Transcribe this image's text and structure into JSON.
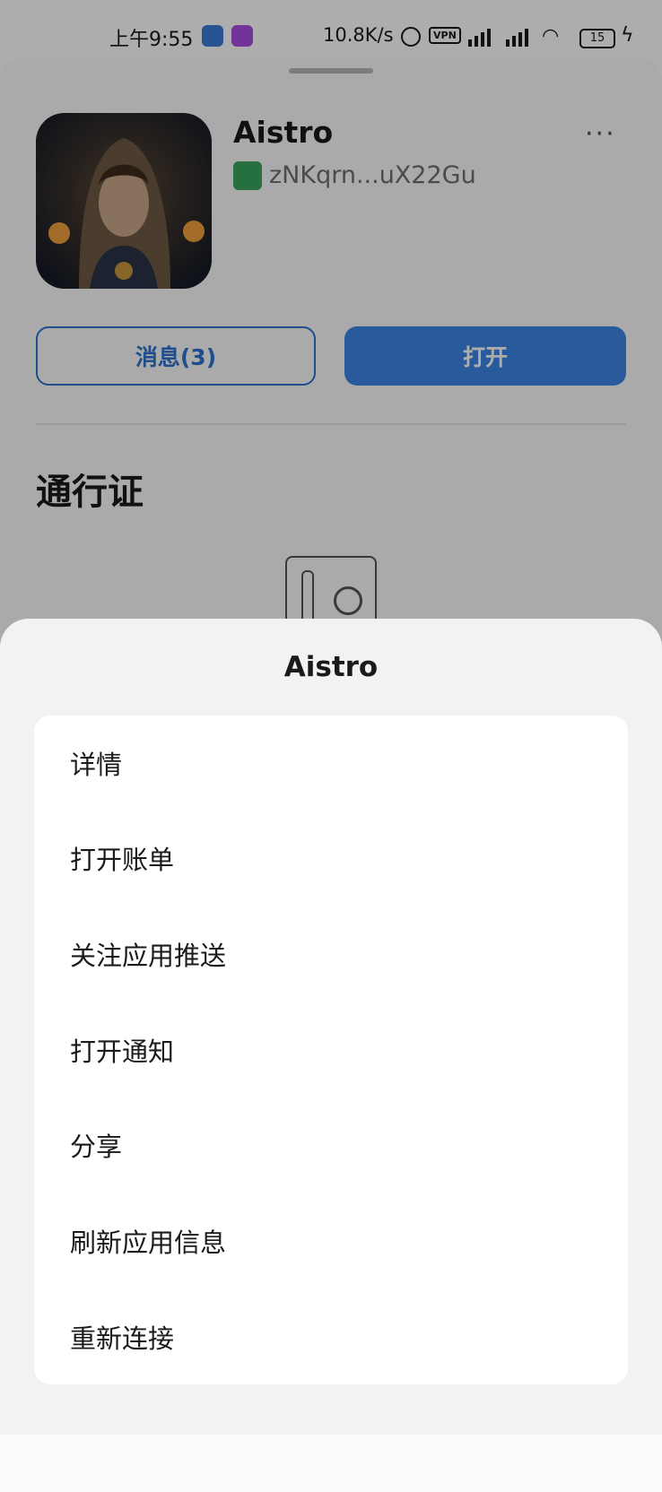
{
  "status_bar": {
    "time": "上午9:55",
    "net_speed": "10.8K/s",
    "vpn": "VPN",
    "battery": "15"
  },
  "app": {
    "name": "Aistro",
    "address": "zNKqrn...uX22Gu",
    "more": "···"
  },
  "buttons": {
    "messages": "消息(3)",
    "open": "打开"
  },
  "pass_section": {
    "title": "通行证"
  },
  "action_sheet": {
    "title": "Aistro",
    "items": [
      {
        "label": "详情"
      },
      {
        "label": "打开账单"
      },
      {
        "label": "关注应用推送"
      },
      {
        "label": "打开通知"
      },
      {
        "label": "分享"
      },
      {
        "label": "刷新应用信息"
      },
      {
        "label": "重新连接"
      }
    ]
  },
  "colors": {
    "accent": "#3d86e6",
    "sheet_bg": "#f2f2f2"
  }
}
